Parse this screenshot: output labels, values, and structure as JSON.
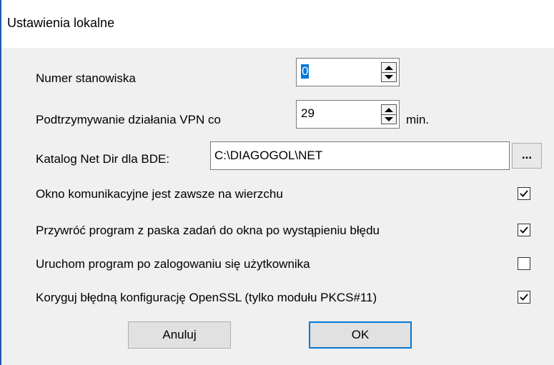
{
  "window": {
    "title": "Ustawienia lokalne"
  },
  "fields": {
    "station_label": "Numer stanowiska",
    "station_value": "0",
    "vpn_label": "Podtrzymywanie działania VPN co",
    "vpn_value": "29",
    "vpn_unit": "min.",
    "netdir_label": "Katalog Net Dir dla BDE:",
    "netdir_value": "C:\\DIAGOGOL\\NET",
    "browse_label": "..."
  },
  "options": [
    {
      "label": "Okno komunikacyjne jest zawsze na wierzchu",
      "checked": true
    },
    {
      "label": "Przywróć program z paska zadań do okna po wystąpieniu błędu",
      "checked": true
    },
    {
      "label": "Uruchom program po zalogowaniu się użytkownika",
      "checked": false
    },
    {
      "label": "Koryguj błędną konfigurację OpenSSL (tylko modułu PKCS#11)",
      "checked": true
    }
  ],
  "buttons": {
    "cancel": "Anuluj",
    "ok": "OK"
  }
}
